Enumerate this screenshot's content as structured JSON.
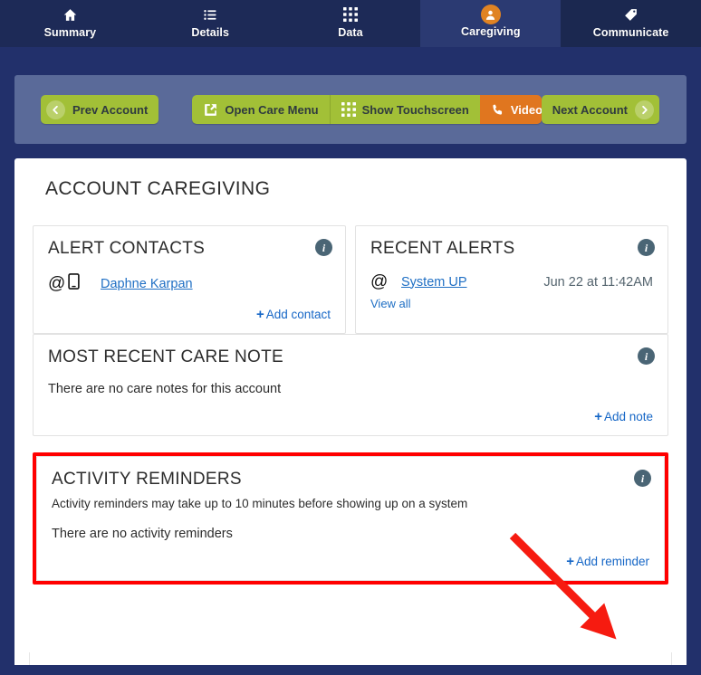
{
  "nav": {
    "tabs": [
      {
        "label": "Summary",
        "icon": "home-icon",
        "state": "default"
      },
      {
        "label": "Details",
        "icon": "list-icon",
        "state": "default"
      },
      {
        "label": "Data",
        "icon": "grid-icon",
        "state": "default"
      },
      {
        "label": "Caregiving",
        "icon": "person-icon",
        "state": "active"
      },
      {
        "label": "Communicate",
        "icon": "tag-icon",
        "state": "semi"
      }
    ]
  },
  "toolbar": {
    "prev_label": "Prev Account",
    "prev_icon": "chevron-left-icon",
    "next_label": "Next Account",
    "next_icon": "chevron-right-icon",
    "group": [
      {
        "label": "Open Care Menu",
        "icon": "external-link-icon",
        "style": "green"
      },
      {
        "label": "Show Touchscreen",
        "icon": "grid-icon",
        "style": "green"
      },
      {
        "label": "Video Call",
        "icon": "phone-icon",
        "style": "orange"
      }
    ]
  },
  "main": {
    "title": "ACCOUNT CAREGIVING",
    "alert_contacts": {
      "heading": "ALERT CONTACTS",
      "info_icon": "info-icon",
      "contact_name": "Daphne Karpan",
      "channel_icons": [
        "at-icon",
        "mobile-icon"
      ],
      "add_label": "Add contact",
      "add_plus": "+"
    },
    "recent_alerts": {
      "heading": "RECENT ALERTS",
      "info_icon": "info-icon",
      "alert_name": "System UP",
      "alert_icon": "at-icon",
      "alert_time": "Jun 22 at 11:42AM",
      "view_all_label": "View all"
    },
    "care_note": {
      "heading": "MOST RECENT CARE NOTE",
      "info_icon": "info-icon",
      "empty_text": "There are no care notes for this account",
      "add_label": "Add note",
      "add_plus": "+"
    },
    "activity_reminders": {
      "heading": "ACTIVITY REMINDERS",
      "info_icon": "info-icon",
      "note": "Activity reminders may take up to 10 minutes before showing up on a system",
      "empty_text": "There are no activity reminders",
      "add_label": "Add reminder",
      "add_plus": "+",
      "highlight_color": "#ff0000",
      "annotation": "red-arrow-pointing-to-add-reminder"
    }
  },
  "colors": {
    "page_bg": "#22306b",
    "nav_bg": "#1d2a57",
    "nav_active": "#2b3a72",
    "toolbar_panel": "#5a6a99",
    "green_button": "#a2c037",
    "orange_button": "#e0761f",
    "avatar_orange": "#e08323",
    "link_blue": "#1566c6",
    "info_slate": "#4a6575",
    "highlight_red": "#ff0000"
  }
}
